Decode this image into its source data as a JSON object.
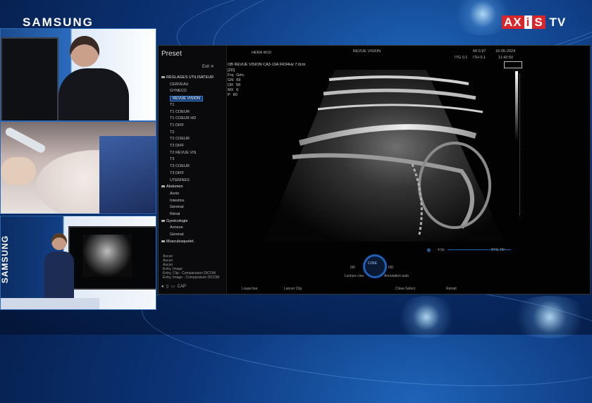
{
  "broadcast": {
    "brand": "SAMSUNG",
    "logo_a": "AX",
    "logo_i": "i",
    "logo_s": "S",
    "logo_tv": "TV",
    "side_brand": "SAMSUNG"
  },
  "preset": {
    "title": "Preset",
    "exit_label": "Exit",
    "close_glyph": "✕",
    "items": [
      {
        "label": "RÉGLAGES UTILISATEUR",
        "type": "group"
      },
      {
        "label": "CERVEAU",
        "type": "item"
      },
      {
        "label": "GYNECO",
        "type": "item"
      },
      {
        "label": "REVUE VISION",
        "type": "selected"
      },
      {
        "label": "T1",
        "type": "item"
      },
      {
        "label": "T1 COEUR",
        "type": "item"
      },
      {
        "label": "T1 COEUR HD",
        "type": "item"
      },
      {
        "label": "T1 DIFF",
        "type": "item"
      },
      {
        "label": "T2",
        "type": "item"
      },
      {
        "label": "T2 COEUR",
        "type": "item"
      },
      {
        "label": "T2 DIFF",
        "type": "item"
      },
      {
        "label": "T2 REVUE VIS",
        "type": "item"
      },
      {
        "label": "T3",
        "type": "item"
      },
      {
        "label": "T3 COEUR",
        "type": "item"
      },
      {
        "label": "T3 DIFF",
        "type": "item"
      },
      {
        "label": "UTERINES",
        "type": "item"
      },
      {
        "label": "Abdomen",
        "type": "group"
      },
      {
        "label": "Aorte",
        "type": "item"
      },
      {
        "label": "Intestins",
        "type": "item"
      },
      {
        "label": "Général",
        "type": "item"
      },
      {
        "label": "Rénal",
        "type": "item"
      },
      {
        "label": "Gynécologie",
        "type": "group"
      },
      {
        "label": "Annexe",
        "type": "item"
      },
      {
        "label": "Général",
        "type": "item"
      },
      {
        "label": "Musculosquelet.",
        "type": "group"
      }
    ],
    "footer_rows": [
      "Aucun",
      "Aucun",
      "Aucun",
      "Entry, Image",
      "Entry, Clip - Comparaison DICOM",
      "Entry, Image - Comparaison DICOM"
    ],
    "tool_label": "CAP"
  },
  "header": {
    "device": "HERA W10",
    "mode": "REVUE VISION",
    "mi": "MI",
    "mi_val": "0.97",
    "date": "16-05-2024",
    "itg": "ITG",
    "itg_val": "0.1",
    "itb": "ITH",
    "itb_val": "0.1",
    "time": "11:42:50",
    "probe_line": "OB REVUE VISION CA3-10A FR34Hz 7.0cm"
  },
  "params": [
    {
      "k": "[2D]",
      "v": ""
    },
    {
      "k": "Frq",
      "v": "Gén."
    },
    {
      "k": "GN",
      "v": "69"
    },
    {
      "k": "DR",
      "v": "58"
    },
    {
      "k": "MX",
      "v": "6"
    },
    {
      "k": "P",
      "v": "80"
    }
  ],
  "bottom": {
    "cine": "CINE",
    "left_val": "0/0",
    "right_val": "0/0",
    "play": "Lecture cine",
    "annot": "Annotation auto",
    "bar_left": "4.0s",
    "bar_right": "RTG 7/0",
    "labels": [
      "Loupe bar",
      "Lancer Clip",
      "Close Select",
      "Retrait"
    ]
  },
  "colors": {
    "accent": "#1f5fb8",
    "logo_red": "#d8262c",
    "screen_bg": "#020203",
    "selected": "#123b72"
  }
}
